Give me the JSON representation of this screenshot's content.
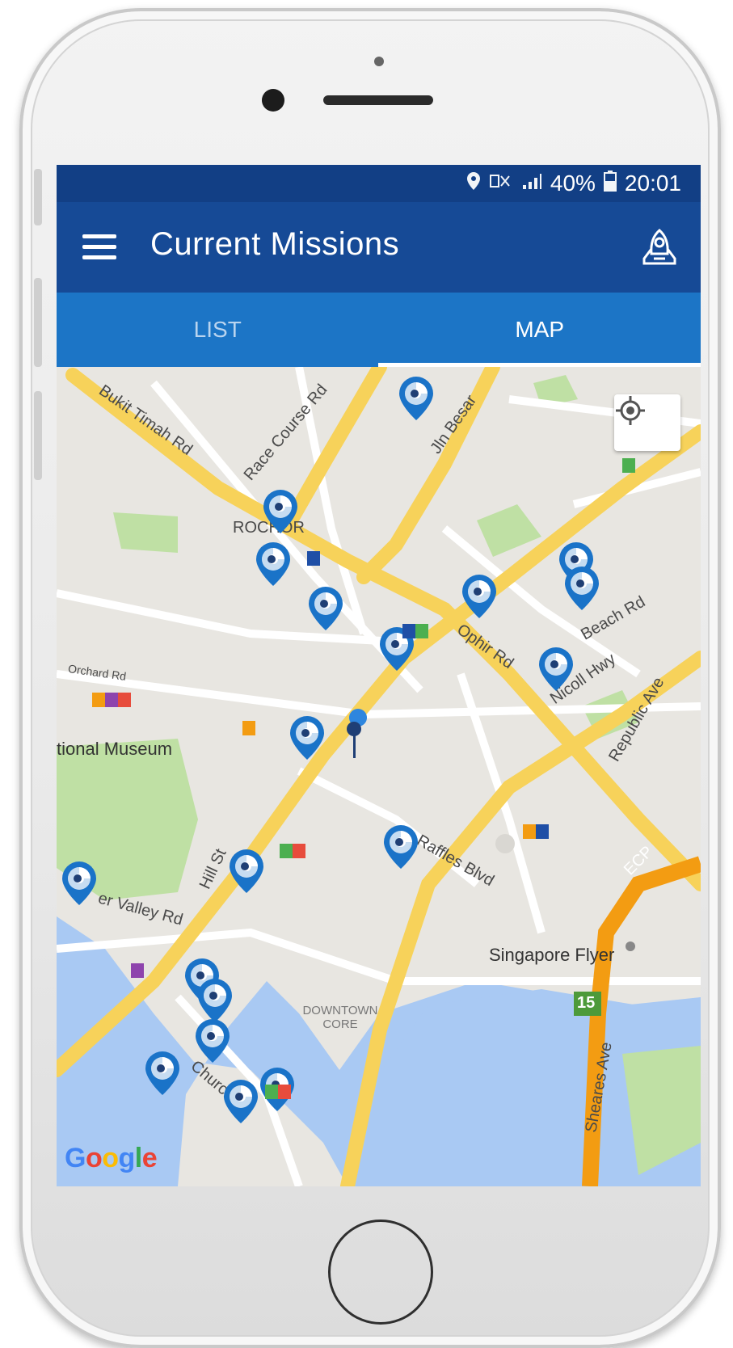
{
  "status_bar": {
    "signal_text": "◢",
    "battery": "40%",
    "time": "20:01"
  },
  "toolbar": {
    "title": "Current Missions"
  },
  "tabs": [
    {
      "label": "LIST",
      "active": false
    },
    {
      "label": "MAP",
      "active": true
    }
  ],
  "map": {
    "street_labels": {
      "bukit_timah": "Bukit Timah Rd",
      "race_course": "Race Course Rd",
      "jln_besar": "Jln Besar",
      "rochor": "ROCHOR",
      "ophir": "Ophir Rd",
      "beach": "Beach Rd",
      "nicoll": "Nicoll Hwy",
      "republic": "Republic Ave",
      "orchard": "Orchard Rd",
      "raffles": "Raffles Blvd",
      "hill": "Hill St",
      "river_valley": "er Valley Rd",
      "downtown": "DOWNTOWN CORE",
      "church": "Church St",
      "sheares": "Sheares Ave",
      "ecp": "ECP",
      "highway_number": "15"
    },
    "places": {
      "museum": "tional Museum",
      "flyer": "Singapore Flyer"
    },
    "attribution": "Google"
  },
  "colors": {
    "status_bar": "#123f85",
    "toolbar": "#164a96",
    "tabs": "#1c75c6",
    "pin": "#1a73c8",
    "road_major": "#f7d25a",
    "road_expressway": "#f39c12",
    "water": "#a9c9f3",
    "park": "#bfe0a4"
  }
}
